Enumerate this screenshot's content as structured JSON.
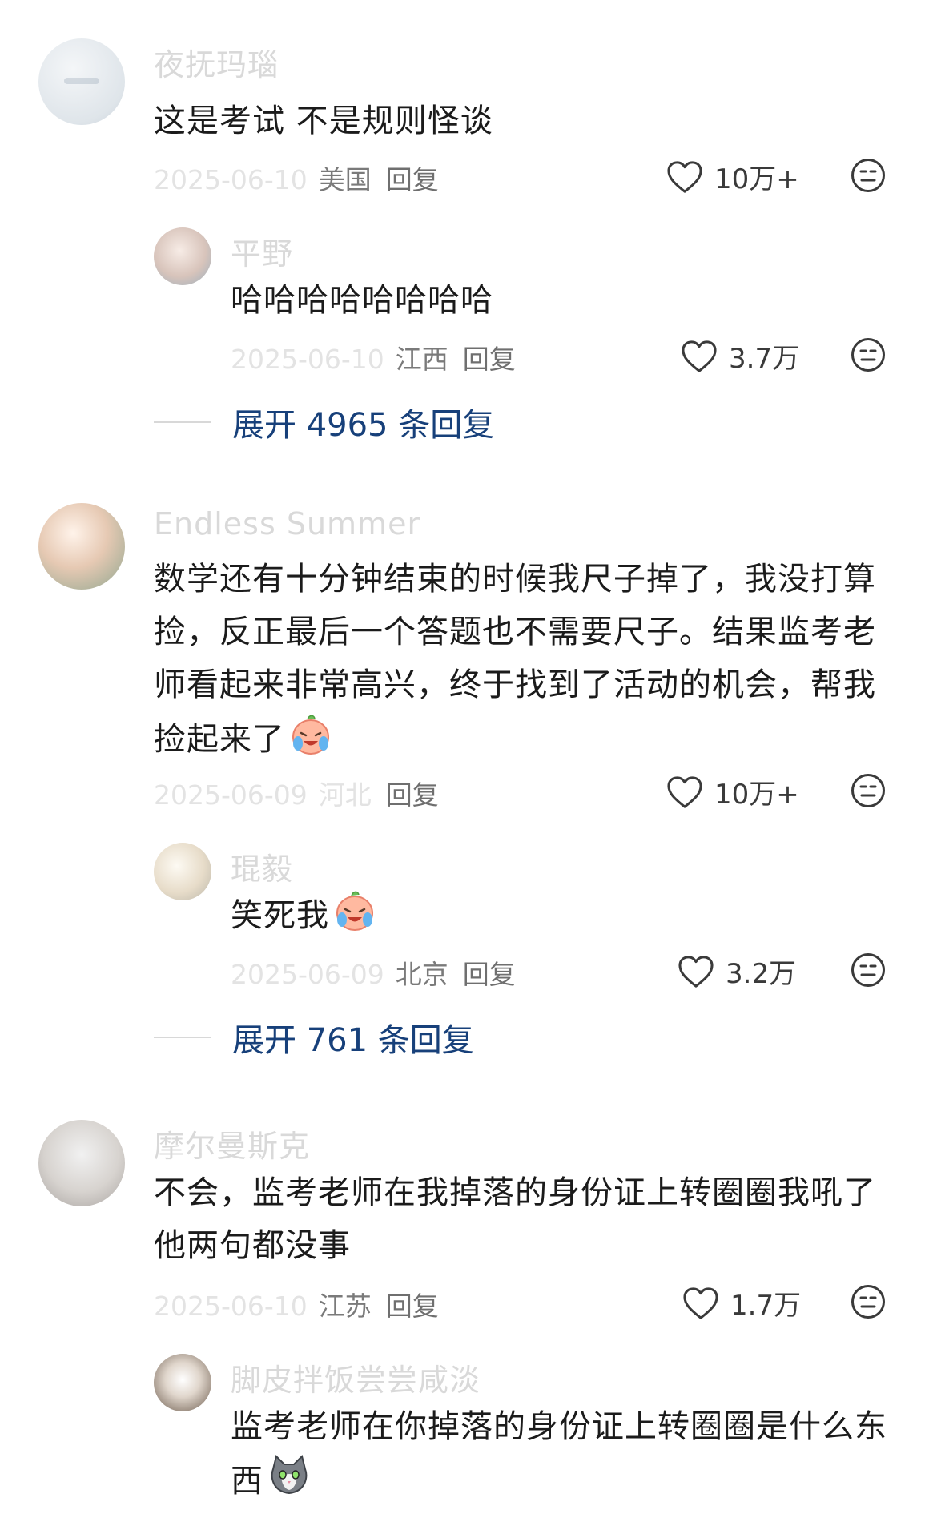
{
  "comments": [
    {
      "username": "夜抚玛瑙",
      "text": "这是考试 不是规则怪谈",
      "date": "2025-06-10",
      "location": "美国",
      "reply": "回复",
      "likes": "10万+",
      "replies": [
        {
          "username": "平野",
          "text": "哈哈哈哈哈哈哈哈",
          "date": "2025-06-10",
          "location": "江西",
          "reply": "回复",
          "likes": "3.7万"
        }
      ],
      "expand": "展开 4965 条回复"
    },
    {
      "username": "Endless Summer",
      "text": "数学还有十分钟结束的时候我尺子掉了，我没打算捡，反正最后一个答题也不需要尺子。结果监考老师看起来非常高兴，终于找到了活动的机会，帮我捡起来了",
      "date": "2025-06-09",
      "location": "河北",
      "reply": "回复",
      "likes": "10万+",
      "replies": [
        {
          "username": "琨毅",
          "text": "笑死我",
          "date": "2025-06-09",
          "location": "北京",
          "reply": "回复",
          "likes": "3.2万"
        }
      ],
      "expand": "展开 761 条回复"
    },
    {
      "username": "摩尔曼斯克",
      "text": "不会，监考老师在我掉落的身份证上转圈圈我吼了他两句都没事",
      "date": "2025-06-10",
      "location": "江苏",
      "reply": "回复",
      "likes": "1.7万",
      "replies": [
        {
          "username": "脚皮拌饭尝尝咸淡",
          "text": "监考老师在你掉落的身份证上转圈圈是什么东西"
        }
      ]
    }
  ],
  "icons": {
    "like": "heart-outline-icon",
    "dislike": "neutral-face-icon",
    "emoji_crying": "crying-laughing-emoji",
    "emoji_cat": "cat-emoji"
  },
  "colors": {
    "link": "#17407a",
    "muted": "#9a9a9a"
  }
}
